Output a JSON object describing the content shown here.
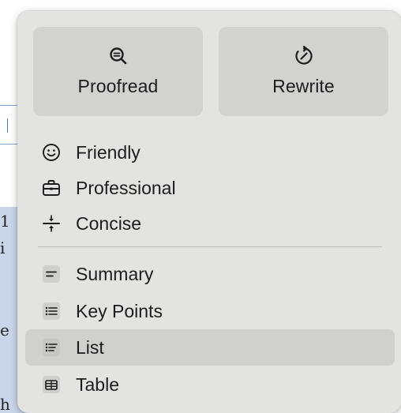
{
  "background": {
    "glyphs": [
      "1",
      "i",
      "e",
      "h"
    ]
  },
  "actions": {
    "proofread": {
      "label": "Proofread",
      "icon": "magnifier-check-icon"
    },
    "rewrite": {
      "label": "Rewrite",
      "icon": "rewrite-arrows-icon"
    }
  },
  "tones": [
    {
      "label": "Friendly",
      "icon": "smiley-icon"
    },
    {
      "label": "Professional",
      "icon": "briefcase-icon"
    },
    {
      "label": "Concise",
      "icon": "compress-icon"
    }
  ],
  "formats": [
    {
      "label": "Summary",
      "icon": "summary-lines-icon"
    },
    {
      "label": "Key Points",
      "icon": "bullet-list-icon"
    },
    {
      "label": "List",
      "icon": "list-icon",
      "highlighted": true
    },
    {
      "label": "Table",
      "icon": "table-icon"
    }
  ],
  "colors": {
    "panel": "#e3e3e1",
    "button": "#d2d2d0",
    "hover": "#d0d0ce",
    "text": "#1d1d1f"
  }
}
